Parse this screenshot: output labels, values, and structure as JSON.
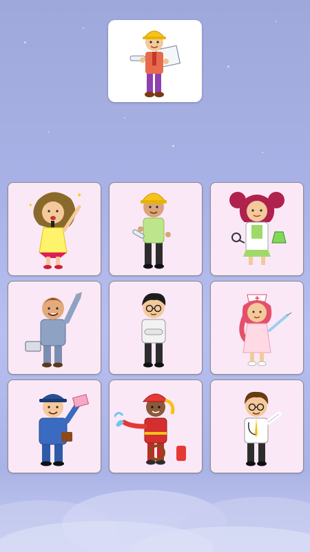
{
  "game": {
    "target": {
      "character": "engineer"
    },
    "cards": [
      {
        "character": "singer"
      },
      {
        "character": "engineer"
      },
      {
        "character": "scientist"
      },
      {
        "character": "mechanic"
      },
      {
        "character": "office-worker"
      },
      {
        "character": "nurse"
      },
      {
        "character": "postman"
      },
      {
        "character": "firefighter"
      },
      {
        "character": "doctor"
      }
    ]
  },
  "colors": {
    "background_top": "#9fa8da",
    "background_bottom": "#c8cdf2",
    "card_background": "#fbe8f7",
    "card_border": "#8a8a8a",
    "target_background": "#ffffff"
  }
}
